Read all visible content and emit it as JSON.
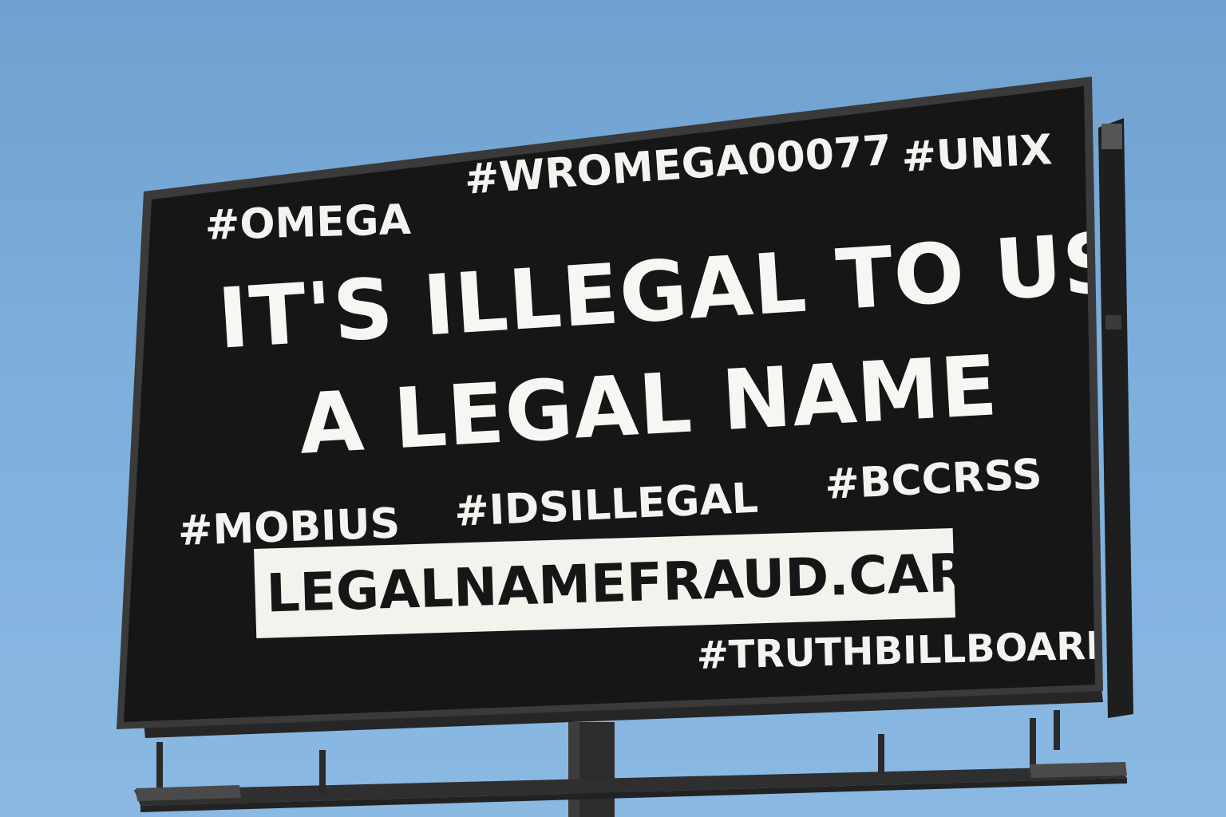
{
  "billboard": {
    "hashtags_top": [
      "#OMEGA",
      "#WROMEGA00077",
      "#UNIX"
    ],
    "headline_line1": "IT'S ILLEGAL TO USE",
    "headline_line2": "A LEGAL NAME",
    "hashtags_bottom": [
      "#MOBIUS",
      "#IDSILLEGAL",
      "#BCCRSS"
    ],
    "url": "LEGALNAMEFRAUD.CARRD.CO",
    "footer_tag": "#TRUTHBILLBOARDS"
  },
  "colors": {
    "sky": "#74a6d4",
    "board_face": "#161616",
    "frame": "#3b3b3b",
    "text": "#f3f3ef",
    "url_box": "#f3f3ee",
    "steel": "#2b2b2b"
  }
}
